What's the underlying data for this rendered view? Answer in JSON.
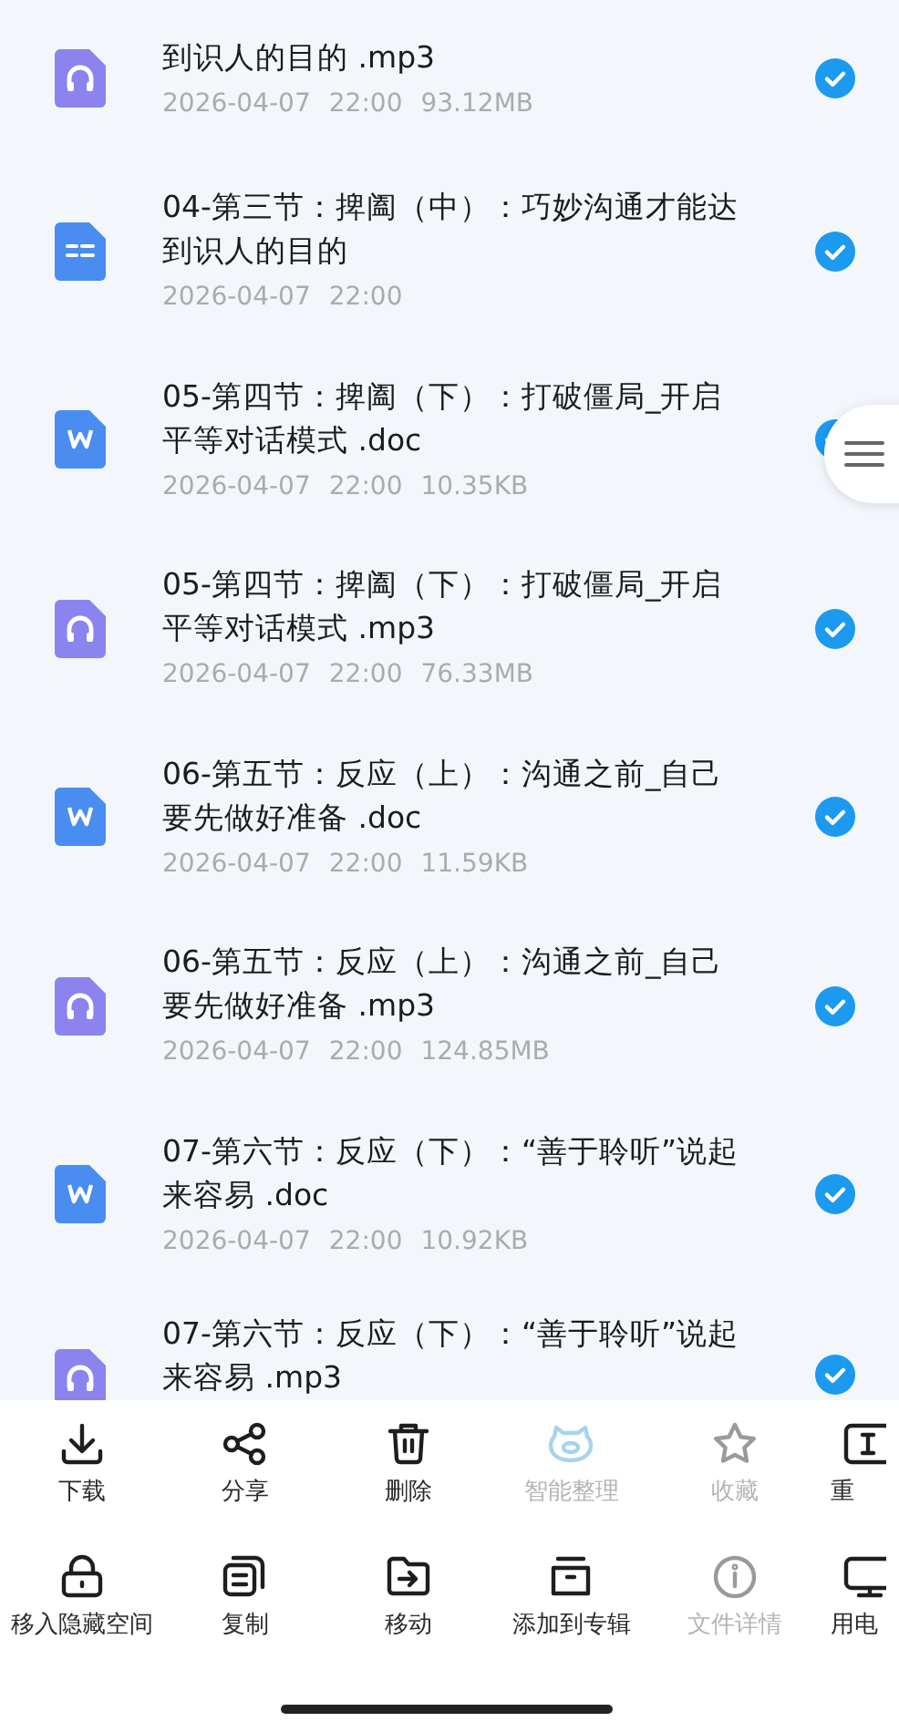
{
  "files": [
    {
      "kind": "audio",
      "title": "到识人的目的 .mp3",
      "date": "2026-04-07",
      "time": "22:00",
      "size": "93.12MB",
      "selected": true
    },
    {
      "kind": "note",
      "title": "04-第三节：捭阖（中）：巧妙沟通才能达到识人的目的",
      "date": "2026-04-07",
      "time": "22:00",
      "selected": true
    },
    {
      "kind": "word",
      "title": "05-第四节：捭阖（下）：打破僵局_开启平等对话模式 .doc",
      "date": "2026-04-07",
      "time": "22:00",
      "size": "10.35KB",
      "selected": true
    },
    {
      "kind": "audio",
      "title": "05-第四节：捭阖（下）：打破僵局_开启平等对话模式 .mp3",
      "date": "2026-04-07",
      "time": "22:00",
      "size": "76.33MB",
      "selected": true
    },
    {
      "kind": "word",
      "title": "06-第五节：反应（上）：沟通之前_自己要先做好准备 .doc",
      "date": "2026-04-07",
      "time": "22:00",
      "size": "11.59KB",
      "selected": true
    },
    {
      "kind": "audio",
      "title": "06-第五节：反应（上）：沟通之前_自己要先做好准备 .mp3",
      "date": "2026-04-07",
      "time": "22:00",
      "size": "124.85MB",
      "selected": true
    },
    {
      "kind": "word",
      "title": "07-第六节：反应（下）：“善于聆听”说起来容易 .doc",
      "date": "2026-04-07",
      "time": "22:00",
      "size": "10.92KB",
      "selected": true
    },
    {
      "kind": "audio",
      "title": "07-第六节：反应（下）：“善于聆听”说起来容易 .mp3",
      "selected": true
    }
  ],
  "actions": [
    [
      {
        "label": "下载",
        "disabled": false
      },
      {
        "label": "分享",
        "disabled": false
      },
      {
        "label": "删除",
        "disabled": false
      },
      {
        "label": "智能整理",
        "disabled": true
      },
      {
        "label": "收藏",
        "disabled": true
      },
      {
        "label": "重",
        "disabled": false
      }
    ],
    [
      {
        "label": "移入隐藏空间",
        "disabled": false
      },
      {
        "label": "复制",
        "disabled": false
      },
      {
        "label": "移动",
        "disabled": false
      },
      {
        "label": "添加到专辑",
        "disabled": false
      },
      {
        "label": "文件详情",
        "disabled": true
      },
      {
        "label": "用电",
        "disabled": false
      }
    ]
  ]
}
